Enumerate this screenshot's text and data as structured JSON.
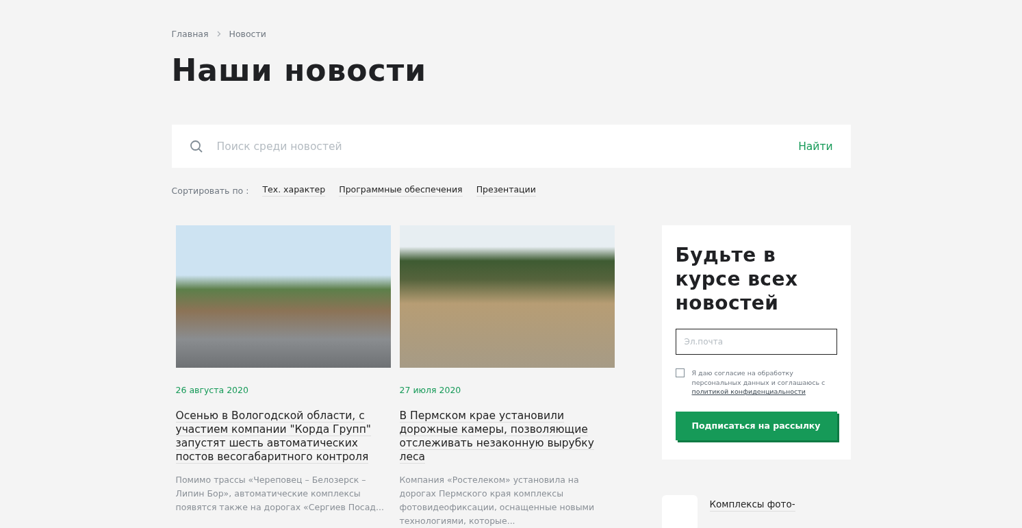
{
  "breadcrumbs": [
    {
      "label": "Главная"
    },
    {
      "label": "Новости"
    }
  ],
  "title": "Наши новости",
  "search": {
    "placeholder": "Поиск среди новостей",
    "button": "Найти"
  },
  "sort": {
    "label": "Сортировать по :",
    "options": [
      {
        "label": "Тех. характер"
      },
      {
        "label": "Программные обеспечения"
      },
      {
        "label": "Презентации"
      }
    ]
  },
  "news": [
    {
      "date": "26 августа 2020",
      "title": "Осенью в Вологодской области, с участием компании \"Корда Групп\" запустят шесть автоматических постов весогабаритного контроля",
      "excerpt": "Помимо трассы «Череповец – Белозерск – Липин Бор», автоматические комплексы появятся также на дорогах «Сергиев Посад..."
    },
    {
      "date": "27 июля 2020",
      "title": "В Пермском крае установили дорожные камеры, позволяющие отслеживать незаконную вырубку леса",
      "excerpt": "Компания «Ростелеком» установила на дорогах Пермского края комплексы фотовидеофиксации, оснащенные новыми технологиями, которые..."
    }
  ],
  "subscribe": {
    "title": "Будьте в курсе всех новостей",
    "email_placeholder": "Эл.почта",
    "consent_text": "Я даю согласие на обработку персональных данных и соглашаюсь с",
    "consent_link": "политикой конфиденциальности",
    "checked": false,
    "button": "Подписаться на рассылку"
  },
  "related": [
    {
      "title": "Комплексы фото-"
    }
  ]
}
